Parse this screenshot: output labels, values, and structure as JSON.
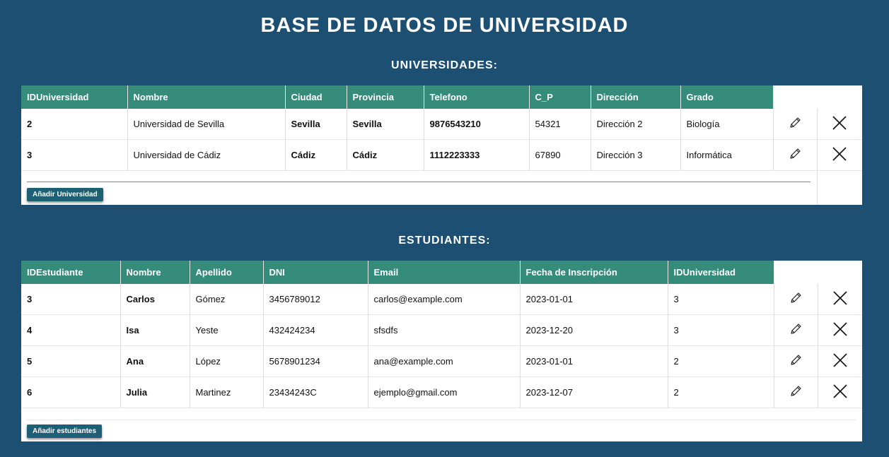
{
  "page": {
    "title": "BASE DE DATOS DE UNIVERSIDAD"
  },
  "universities": {
    "section_title": "UNIVERSIDADES:",
    "columns": [
      "IDUniversidad",
      "Nombre",
      "Ciudad",
      "Provincia",
      "Telefono",
      "C_P",
      "Dirección",
      "Grado"
    ],
    "rows": [
      [
        "2",
        "Universidad de Sevilla",
        "Sevilla",
        "Sevilla",
        "9876543210",
        "54321",
        "Dirección 2",
        "Biología"
      ],
      [
        "3",
        "Universidad de Cádiz",
        "Cádiz",
        "Cádiz",
        "1112223333",
        "67890",
        "Dirección 3",
        "Informática"
      ]
    ],
    "add_button": "Añadir Universidad"
  },
  "students": {
    "section_title": "ESTUDIANTES:",
    "columns": [
      "IDEstudiante",
      "Nombre",
      "Apellido",
      "DNI",
      "Email",
      "Fecha de Inscripción",
      "IDUniversidad"
    ],
    "rows": [
      [
        "3",
        "Carlos",
        "Gómez",
        "3456789012",
        "carlos@example.com",
        "2023-01-01",
        "3"
      ],
      [
        "4",
        "Isa",
        "Yeste",
        "432424234",
        "sfsdfs",
        "2023-12-20",
        "3"
      ],
      [
        "5",
        "Ana",
        "López",
        "5678901234",
        "ana@example.com",
        "2023-01-01",
        "2"
      ],
      [
        "6",
        "Julia",
        "Martinez",
        "23434243C",
        "ejemplo@gmail.com",
        "2023-12-07",
        "2"
      ]
    ],
    "add_button": "Añadir estudiantes"
  },
  "icons": {
    "edit": "pencil-icon",
    "delete": "close-icon"
  },
  "colors": {
    "background": "#1d4f72",
    "header": "#368c7a",
    "button": "#1d5f74"
  }
}
